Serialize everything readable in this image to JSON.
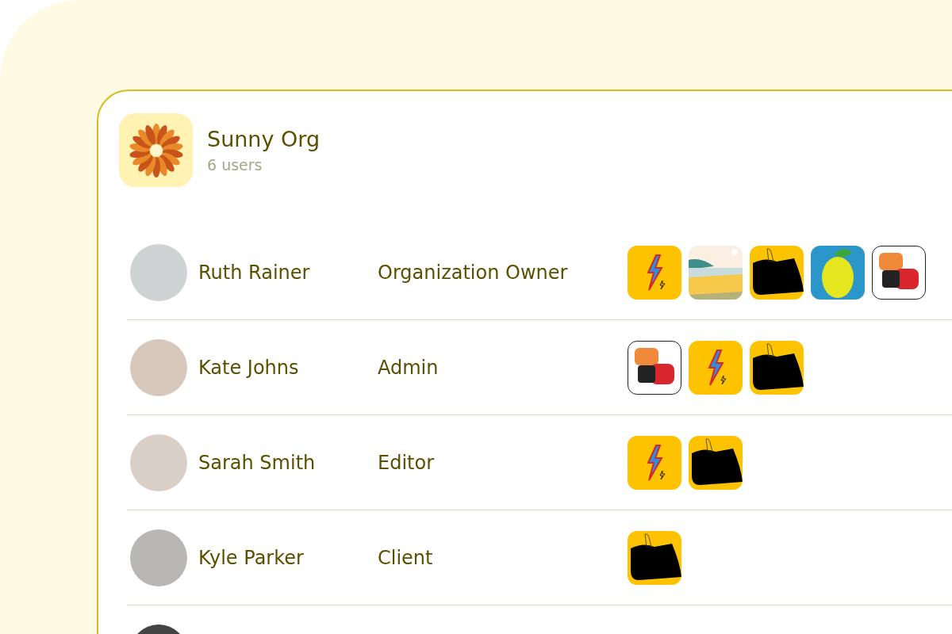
{
  "org": {
    "name": "Sunny Org",
    "count": "6 users"
  },
  "users": [
    {
      "name": "Ruth Rainer",
      "role": "Organization Owner",
      "apps": [
        {
          "kind": "bolt"
        },
        {
          "kind": "beach"
        },
        {
          "kind": "figure"
        },
        {
          "kind": "lemon"
        },
        {
          "kind": "graffiti"
        }
      ]
    },
    {
      "name": "Kate Johns",
      "role": "Admin",
      "apps": [
        {
          "kind": "graffiti"
        },
        {
          "kind": "bolt"
        },
        {
          "kind": "figure"
        }
      ]
    },
    {
      "name": "Sarah Smith",
      "role": "Editor",
      "apps": [
        {
          "kind": "bolt"
        },
        {
          "kind": "figure"
        }
      ]
    },
    {
      "name": "Kyle Parker",
      "role": "Client",
      "apps": [
        {
          "kind": "figure"
        }
      ]
    }
  ]
}
